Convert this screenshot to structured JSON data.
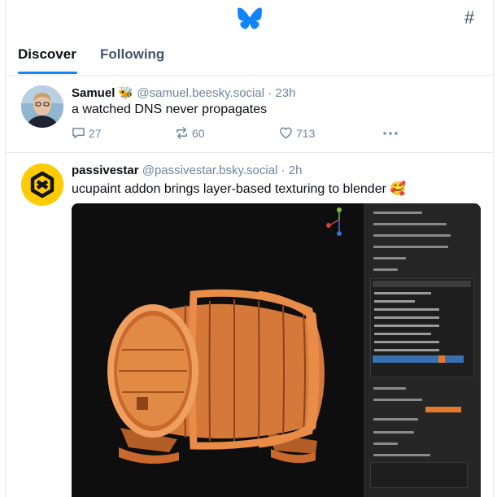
{
  "header": {
    "logo_icon": "butterfly-icon",
    "feeds_icon": "hash-icon"
  },
  "tabs": [
    {
      "label": "Discover",
      "active": true
    },
    {
      "label": "Following",
      "active": false
    }
  ],
  "posts": [
    {
      "display_name": "Samuel 🐝",
      "handle": "@samuel.beesky.social",
      "time": "· 23h",
      "text": "a watched DNS never propagates",
      "replies": "27",
      "reposts": "60",
      "likes": "713"
    },
    {
      "display_name": "passivestar",
      "handle": "@passivestar.bsky.social",
      "time": "· 2h",
      "text": "ucupaint addon brings layer-based texturing to blender 🥰",
      "image_description_icon": "blender-barrel-screenshot"
    }
  ],
  "colors": {
    "accent": "#1083fe",
    "muted": "#6f869f",
    "barrel": "#d5793a"
  }
}
